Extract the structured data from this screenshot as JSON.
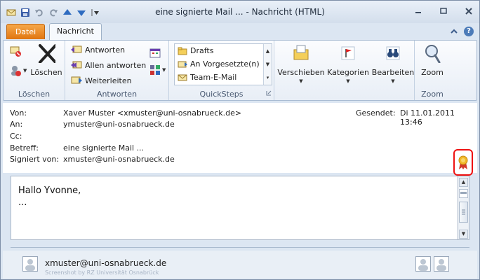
{
  "window": {
    "title": "eine signierte Mail ...  -  Nachricht (HTML)"
  },
  "tabs": {
    "file": "Datei",
    "message": "Nachricht"
  },
  "ribbon": {
    "delete_group": {
      "label": "Löschen",
      "delete_button": "Löschen"
    },
    "respond_group": {
      "label": "Antworten",
      "reply": "Antworten",
      "reply_all": "Allen antworten",
      "forward": "Weiterleiten"
    },
    "quicksteps_group": {
      "label": "QuickSteps",
      "items": [
        "Drafts",
        "An Vorgesetzte(n)",
        "Team-E-Mail"
      ]
    },
    "move": "Verschieben",
    "categorize": "Kategorien",
    "editing": "Bearbeiten",
    "zoom_group": {
      "label": "Zoom",
      "zoom_button": "Zoom"
    }
  },
  "header": {
    "from_label": "Von:",
    "from_value": "Xaver Muster <xmuster@uni-osnabrueck.de>",
    "to_label": "An:",
    "to_value": "ymuster@uni-osnabrueck.de",
    "cc_label": "Cc:",
    "cc_value": "",
    "subject_label": "Betreff:",
    "subject_value": "eine signierte Mail ...",
    "signed_label": "Signiert von:",
    "signed_value": "xmuster@uni-osnabrueck.de",
    "sent_label": "Gesendet:",
    "sent_value": "Di 11.01.2011 13:46"
  },
  "body": {
    "line1": "Hallo Yvonne,",
    "line2": "..."
  },
  "people_pane": {
    "name": "xmuster@uni-osnabrueck.de",
    "watermark": "Screenshot by RZ Universität Osnabrück"
  },
  "colors": {
    "file_tab": "#e07510",
    "signature_highlight": "#e11111",
    "accent_blue": "#2e6bc0"
  }
}
